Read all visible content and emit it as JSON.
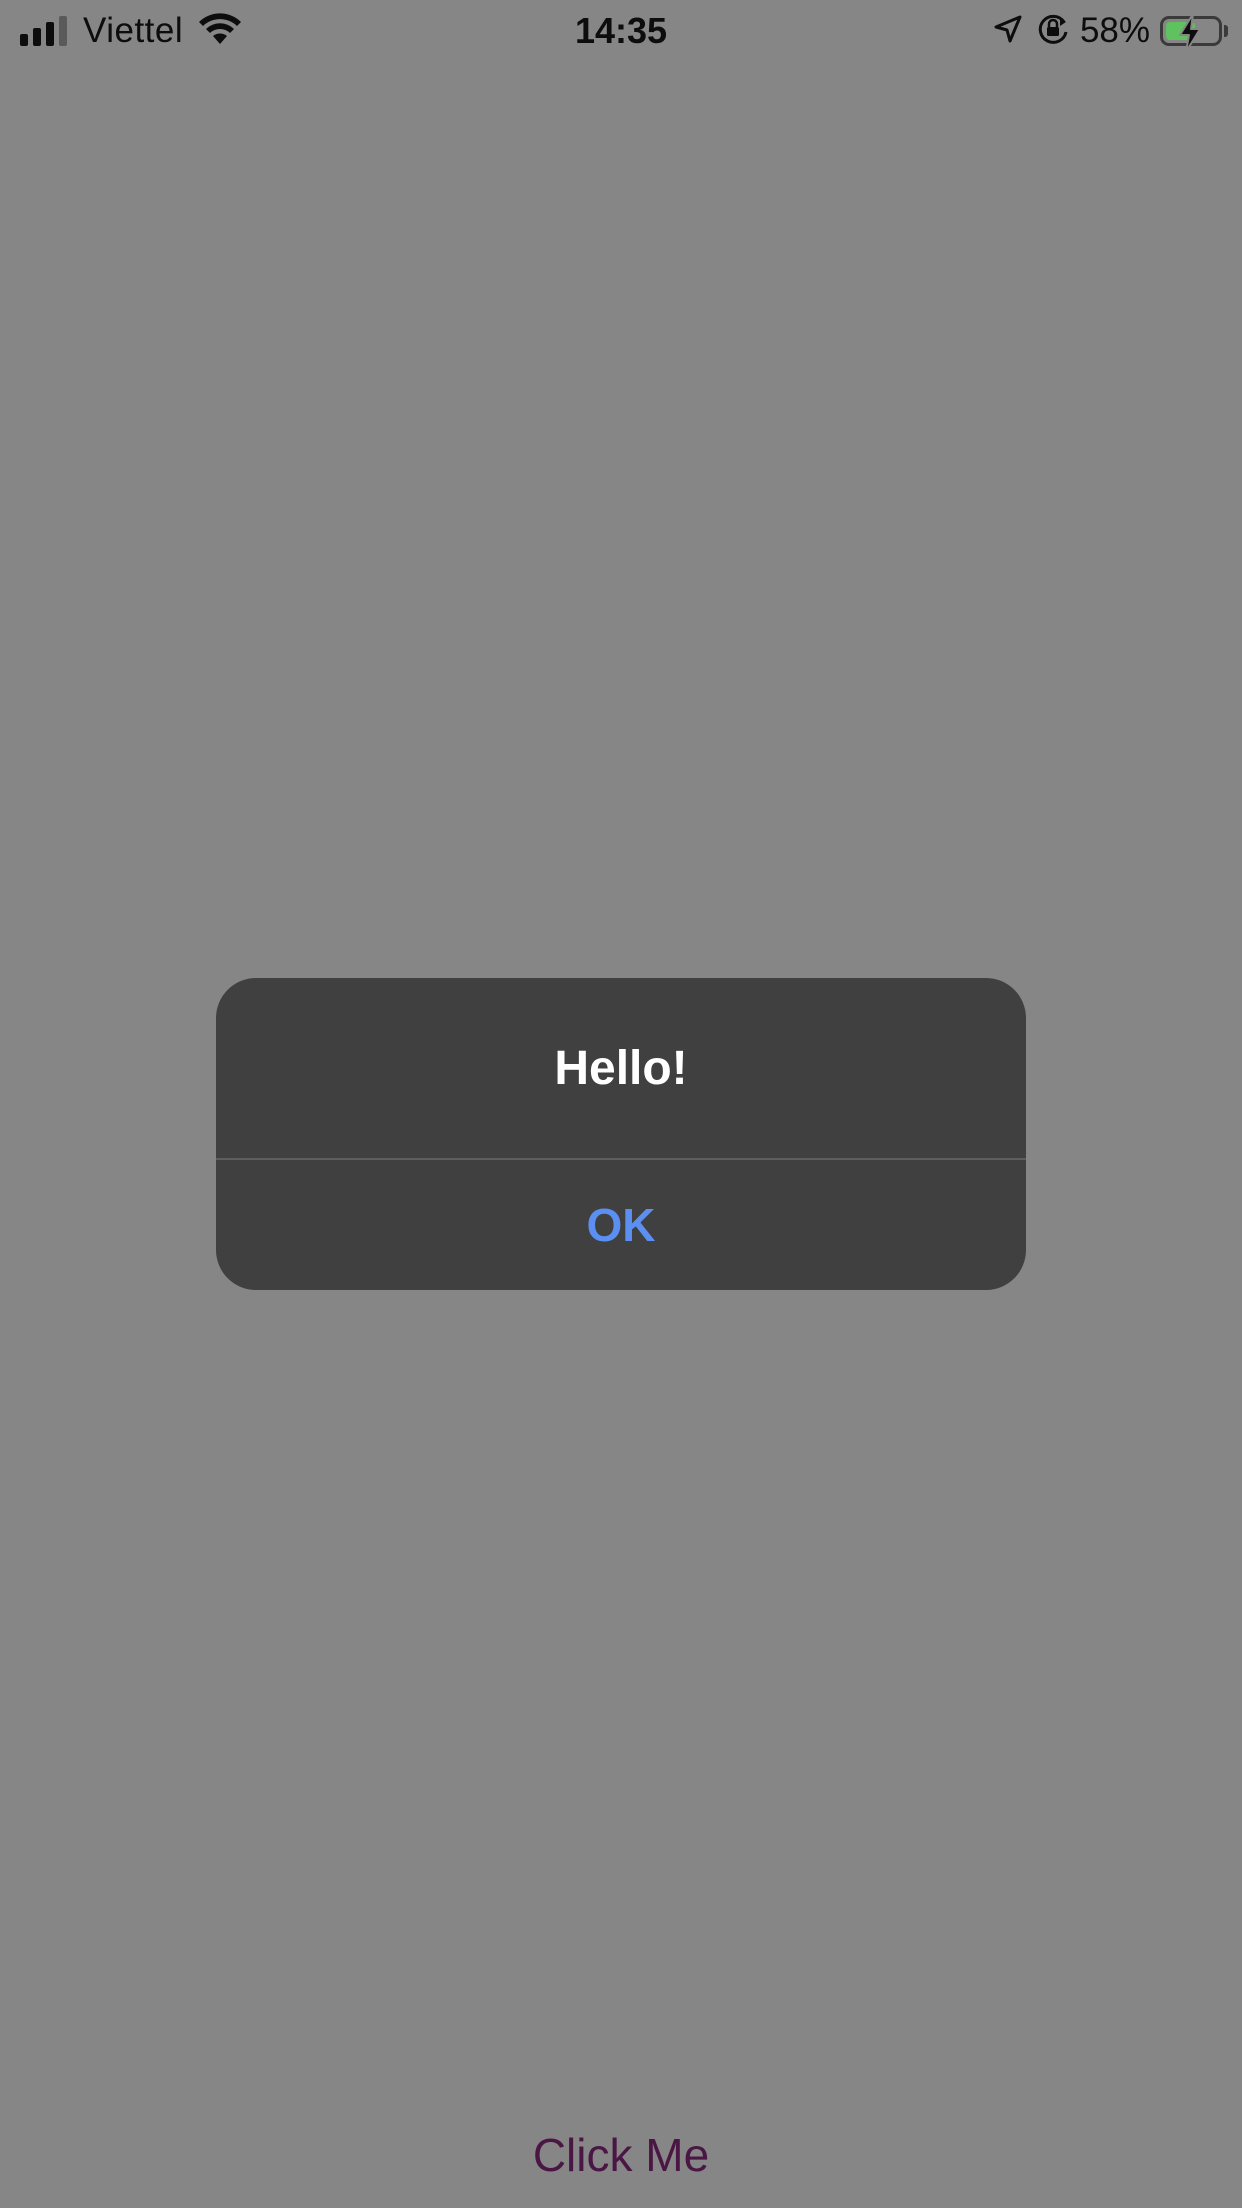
{
  "status_bar": {
    "carrier": "Viettel",
    "time": "14:35",
    "battery_percent": "58%",
    "battery_level": 0.58,
    "battery_color": "#5fc25f",
    "icons": [
      "signal-icon",
      "wifi-icon",
      "location-arrow-icon",
      "rotation-lock-icon",
      "battery-charging-icon"
    ]
  },
  "alert": {
    "title": "Hello!",
    "ok_label": "OK",
    "ok_color": "#5b8ff2"
  },
  "main": {
    "button_label": "Click Me"
  }
}
